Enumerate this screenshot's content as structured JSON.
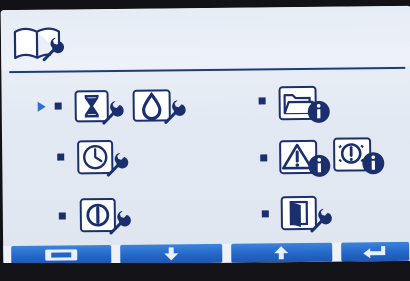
{
  "header": {
    "icon": "book-wrench-icon"
  },
  "colors": {
    "panel": "#e6ecf6",
    "icon_outline": "#1b2f6e",
    "bullet": "#1b2f6e",
    "cursor": "#2b6fd8",
    "softkey": "#2364c4",
    "softkey_glyph": "#e8f0ff"
  },
  "menu": {
    "selected_index": 0,
    "items": [
      {
        "id": "service-timer",
        "icons": [
          "hourglass-wrench-icon",
          "oil-drop-wrench-icon"
        ]
      },
      {
        "id": "clock-settings",
        "icons": [
          "clock-wrench-icon"
        ]
      },
      {
        "id": "power-settings",
        "icons": [
          "power-wrench-icon"
        ]
      },
      {
        "id": "file-info",
        "icons": [
          "folder-info-icon"
        ]
      },
      {
        "id": "alarm-info",
        "icons": [
          "warning-info-icon",
          "engine-info-icon"
        ]
      },
      {
        "id": "display-settings",
        "icons": [
          "door-wrench-icon"
        ]
      }
    ]
  },
  "softkeys": [
    {
      "id": "back",
      "icon": "back-bar-icon"
    },
    {
      "id": "down",
      "icon": "arrow-down-icon"
    },
    {
      "id": "up",
      "icon": "arrow-up-icon"
    },
    {
      "id": "enter",
      "icon": "enter-icon"
    }
  ]
}
